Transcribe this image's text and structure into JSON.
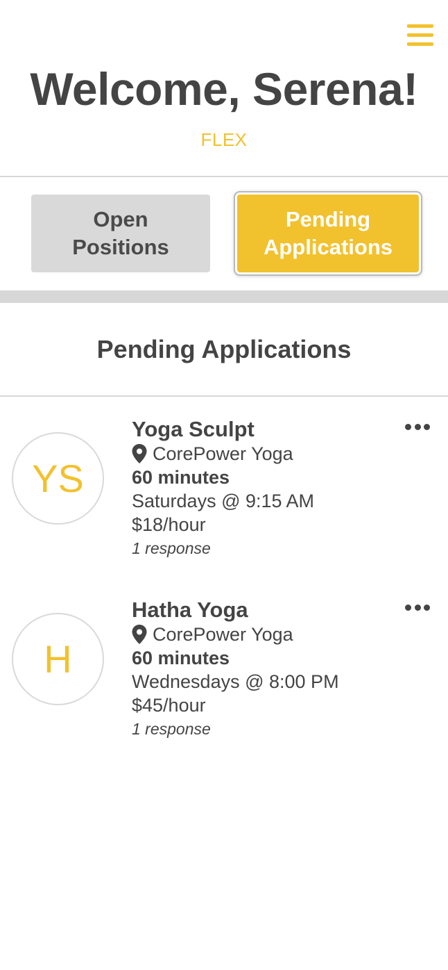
{
  "header": {
    "welcome": "Welcome, Serena!",
    "subtitle": "FLEX",
    "menu_icon": "hamburger-menu-icon"
  },
  "tabs": [
    {
      "label": "Open\nPositions",
      "selected": false
    },
    {
      "label": "Pending\nApplications",
      "selected": true
    }
  ],
  "section_title": "Pending Applications",
  "applications": [
    {
      "initials": "YS",
      "title": "Yoga Sculpt",
      "location": "CorePower Yoga",
      "duration": "60 minutes",
      "schedule": "Saturdays @ 9:15 AM",
      "rate": "$18/hour",
      "responses": "1 response"
    },
    {
      "initials": "H",
      "title": "Hatha Yoga",
      "location": "CorePower Yoga",
      "duration": "60 minutes",
      "schedule": "Wednesdays @ 8:00 PM",
      "rate": "$45/hour",
      "responses": "1 response"
    }
  ],
  "colors": {
    "accent": "#f2c12e",
    "text": "#444444",
    "tab_inactive": "#d9d9d9",
    "divider": "#d7d7d7"
  }
}
